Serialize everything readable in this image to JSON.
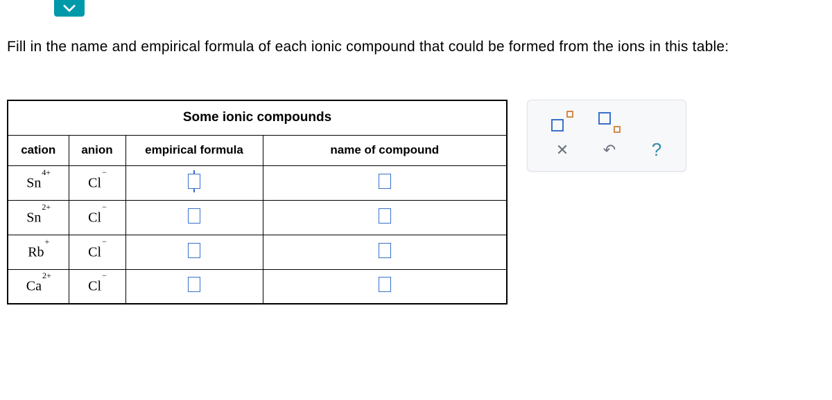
{
  "instruction": "Fill in the name and empirical formula of each ionic compound that could be formed from the ions in this table:",
  "table": {
    "title": "Some ionic compounds",
    "headers": {
      "cation": "cation",
      "anion": "anion",
      "formula": "empirical formula",
      "name": "name of compound"
    },
    "rows": [
      {
        "cation_base": "Sn",
        "cation_charge": "4+",
        "anion_base": "Cl",
        "anion_charge": "−"
      },
      {
        "cation_base": "Sn",
        "cation_charge": "2+",
        "anion_base": "Cl",
        "anion_charge": "−"
      },
      {
        "cation_base": "Rb",
        "cation_charge": "+",
        "anion_base": "Cl",
        "anion_charge": "−"
      },
      {
        "cation_base": "Ca",
        "cation_charge": "2+",
        "anion_base": "Cl",
        "anion_charge": "−"
      }
    ]
  },
  "toolbar": {
    "superscript": "superscript",
    "subscript": "subscript",
    "clear": "clear",
    "undo": "undo",
    "help": "help"
  }
}
